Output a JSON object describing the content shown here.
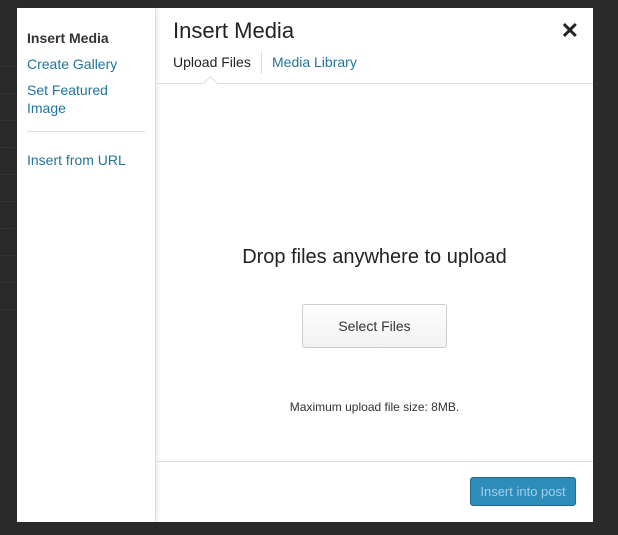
{
  "modal": {
    "title": "Insert Media",
    "close_icon": "close-icon"
  },
  "sidebar": {
    "items": [
      {
        "label": "Insert Media",
        "active": true
      },
      {
        "label": "Create Gallery"
      },
      {
        "label": "Set Featured Image"
      },
      {
        "label": "Insert from URL"
      }
    ]
  },
  "tabs": [
    {
      "label": "Upload Files",
      "active": true
    },
    {
      "label": "Media Library"
    }
  ],
  "upload": {
    "instructions": "Drop files anywhere to upload",
    "select_button": "Select Files",
    "max_size": "Maximum upload file size: 8MB."
  },
  "footer": {
    "insert_button": "Insert into post",
    "insert_disabled": true
  },
  "colors": {
    "link": "#21759b",
    "primary": "#2e8cbb"
  }
}
